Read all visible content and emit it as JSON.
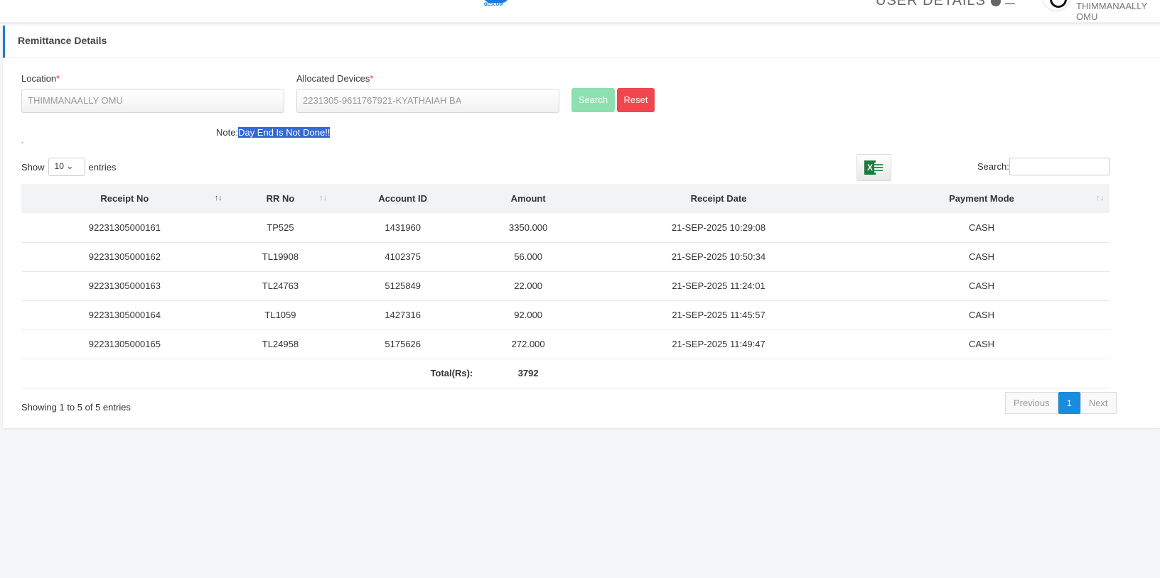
{
  "header": {
    "logo_text": "BESCOM",
    "user_details": "USER DETAILS",
    "user_name": "THIMMANAALLY OMU"
  },
  "page_title": "Remittance Details",
  "form": {
    "location_label": "Location",
    "location_value": "THIMMANAALLY OMU",
    "devices_label": "Allocated Devices",
    "devices_value": "2231305-9611767921-KYATHAIAH BA",
    "required_mark": "*",
    "search_label": "Search",
    "reset_label": "Reset"
  },
  "note": {
    "prefix": "Note:",
    "message": "Day End Is Not Done!!"
  },
  "stray": "`",
  "table_controls": {
    "show": "Show",
    "entries_value": "10",
    "entries": "entries",
    "search_label": "Search:",
    "excel_icon": "excel-icon"
  },
  "columns": [
    "Receipt No",
    "RR No",
    "Account ID",
    "Amount",
    "Receipt Date",
    "Payment Mode"
  ],
  "rows": [
    [
      "92231305000161",
      "TP525",
      "1431960",
      "3350.000",
      "21-SEP-2025 10:29:08",
      "CASH"
    ],
    [
      "92231305000162",
      "TL19908",
      "4102375",
      "56.000",
      "21-SEP-2025 10:50:34",
      "CASH"
    ],
    [
      "92231305000163",
      "TL24763",
      "5125849",
      "22.000",
      "21-SEP-2025 11:24:01",
      "CASH"
    ],
    [
      "92231305000164",
      "TL1059",
      "1427316",
      "92.000",
      "21-SEP-2025 11:45:57",
      "CASH"
    ],
    [
      "92231305000165",
      "TL24958",
      "5175626",
      "272.000",
      "21-SEP-2025 11:49:47",
      "CASH"
    ]
  ],
  "total": {
    "label": "Total(Rs):",
    "value": "3792"
  },
  "footer": {
    "info": "Showing 1 to 5 of 5 entries",
    "previous": "Previous",
    "page": "1",
    "next": "Next"
  },
  "colors": {
    "accent": "#1a8cde",
    "search_btn": "#8ee0b0",
    "reset_btn": "#f0464f",
    "highlight": "#3369d6"
  }
}
